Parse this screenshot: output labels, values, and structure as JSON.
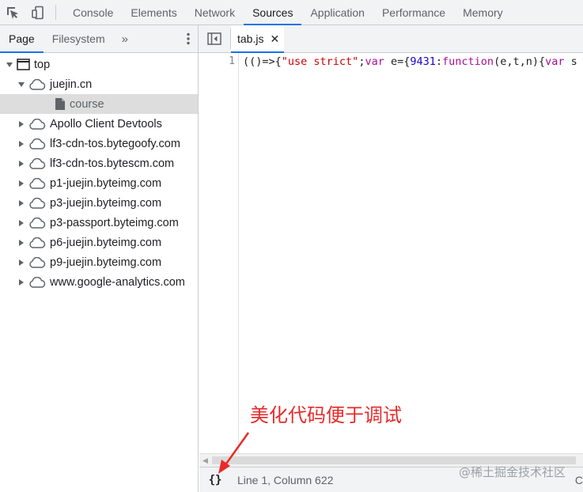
{
  "toolbar": {
    "inspect_icon": "inspect-element-icon",
    "device_icon": "device-toolbar-icon",
    "tabs": [
      "Console",
      "Elements",
      "Network",
      "Sources",
      "Application",
      "Performance",
      "Memory"
    ],
    "active_tab": "Sources"
  },
  "navigator": {
    "tabs": [
      "Page",
      "Filesystem"
    ],
    "active_tab": "Page",
    "more": "»",
    "menu": "⋮",
    "tree": [
      {
        "label": "top",
        "depth": 0,
        "expanded": true,
        "icon": "frame-icon"
      },
      {
        "label": "juejin.cn",
        "depth": 1,
        "expanded": true,
        "icon": "cloud-icon"
      },
      {
        "label": "course",
        "depth": 2,
        "icon": "file-icon",
        "selected": true
      },
      {
        "label": "Apollo Client Devtools",
        "depth": 1,
        "expanded": false,
        "icon": "cloud-icon"
      },
      {
        "label": "lf3-cdn-tos.bytegoofy.com",
        "depth": 1,
        "expanded": false,
        "icon": "cloud-icon"
      },
      {
        "label": "lf3-cdn-tos.bytescm.com",
        "depth": 1,
        "expanded": false,
        "icon": "cloud-icon"
      },
      {
        "label": "p1-juejin.byteimg.com",
        "depth": 1,
        "expanded": false,
        "icon": "cloud-icon"
      },
      {
        "label": "p3-juejin.byteimg.com",
        "depth": 1,
        "expanded": false,
        "icon": "cloud-icon"
      },
      {
        "label": "p3-passport.byteimg.com",
        "depth": 1,
        "expanded": false,
        "icon": "cloud-icon"
      },
      {
        "label": "p6-juejin.byteimg.com",
        "depth": 1,
        "expanded": false,
        "icon": "cloud-icon"
      },
      {
        "label": "p9-juejin.byteimg.com",
        "depth": 1,
        "expanded": false,
        "icon": "cloud-icon"
      },
      {
        "label": "www.google-analytics.com",
        "depth": 1,
        "expanded": false,
        "icon": "cloud-icon"
      }
    ]
  },
  "editor": {
    "file_tab": "tab.js",
    "close": "✕",
    "line_number": "1",
    "code_tokens": [
      {
        "t": "(()=>{",
        "c": ""
      },
      {
        "t": "\"use strict\"",
        "c": "str"
      },
      {
        "t": ";",
        "c": ""
      },
      {
        "t": "var",
        "c": "kw"
      },
      {
        "t": " e={",
        "c": ""
      },
      {
        "t": "9431",
        "c": "num"
      },
      {
        "t": ":",
        "c": ""
      },
      {
        "t": "function",
        "c": "kw"
      },
      {
        "t": "(e,t,n){",
        "c": ""
      },
      {
        "t": "var",
        "c": "kw"
      },
      {
        "t": " s",
        "c": ""
      }
    ]
  },
  "status": {
    "pretty_print": "{}",
    "position": "Line 1, Column 622",
    "trailing": "C"
  },
  "annotation": {
    "text": "美化代码便于调试",
    "color": "#e82a2a"
  },
  "watermark": "@稀土掘金技术社区",
  "colors": {
    "accent": "#1a73e8",
    "string": "#c80000",
    "keyword": "#aa0d91",
    "number": "#1c00cf"
  }
}
